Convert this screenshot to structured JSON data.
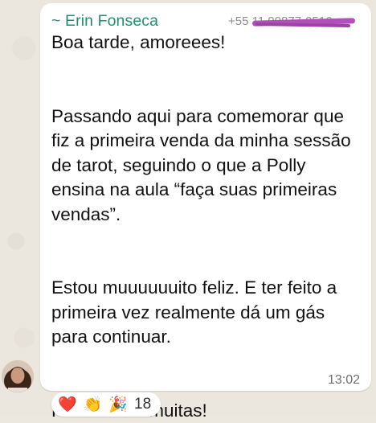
{
  "message": {
    "sender_name": "~ Erin Fonseca",
    "sender_phone": "+55 11 99877-0516",
    "paragraphs": [
      "Boa tarde, amoreees!",
      "Passando aqui para comemorar que fiz a primeira venda da minha sessão de tarot, seguindo o que a Polly ensina na aula “faça suas primeiras vendas”.",
      "Estou muuuuuuito feliz. E ter feito a primeira vez realmente dá um gás para continuar.",
      "Primeira de muitas!"
    ],
    "time": "13:02"
  },
  "reactions": {
    "emojis": [
      {
        "icon": "red-heart-icon",
        "glyph": "❤️"
      },
      {
        "icon": "clapping-hands-icon",
        "glyph": "👏"
      },
      {
        "icon": "party-popper-icon",
        "glyph": "🎉"
      }
    ],
    "count": "18"
  },
  "colors": {
    "sender_name": "#1f8f72",
    "bubble": "#ffffff",
    "background": "#ece7df",
    "redaction": "#b24fb8"
  }
}
